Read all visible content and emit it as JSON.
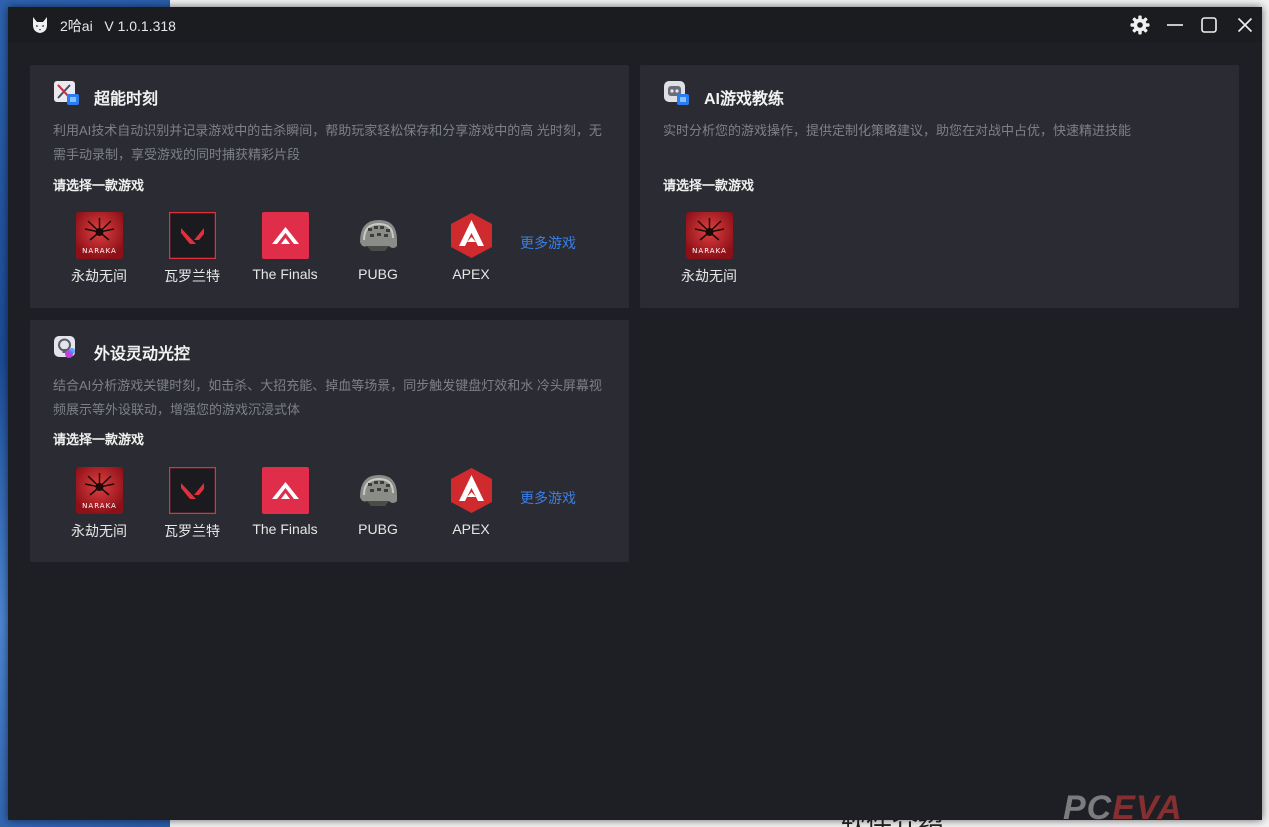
{
  "app": {
    "name_version": "2哈ai   V 1.0.1.318"
  },
  "backdrop": {
    "bottom_text": "软件介绍",
    "watermark_a": "PC",
    "watermark_b": "EVA"
  },
  "cards": [
    {
      "title": "超能时刻",
      "icon": "highlight-moment-icon",
      "description": "利用AI技术自动识别并记录游戏中的击杀瞬间，帮助玩家轻松保存和分享游戏中的高 光时刻，无需手动录制，享受游戏的同时捕获精彩片段",
      "prompt": "请选择一款游戏",
      "more": "更多游戏",
      "games": [
        {
          "label": "永劫无间",
          "icon": "naraka-icon",
          "icon_text": "NARAKA"
        },
        {
          "label": "瓦罗兰特",
          "icon": "valorant-icon"
        },
        {
          "label": "The Finals",
          "icon": "the-finals-icon"
        },
        {
          "label": "PUBG",
          "icon": "pubg-helmet-icon"
        },
        {
          "label": "APEX",
          "icon": "apex-icon"
        }
      ]
    },
    {
      "title": "AI游戏教练",
      "icon": "ai-coach-icon",
      "description": "实时分析您的游戏操作，提供定制化策略建议，助您在对战中占优，快速精进技能",
      "prompt": "请选择一款游戏",
      "games": [
        {
          "label": "永劫无间",
          "icon": "naraka-icon",
          "icon_text": "NARAKA"
        }
      ]
    },
    {
      "title": "外设灵动光控",
      "icon": "peripheral-light-icon",
      "description": "结合AI分析游戏关键时刻，如击杀、大招充能、掉血等场景，同步触发键盘灯效和水 冷头屏幕视频展示等外设联动，增强您的游戏沉浸式体",
      "prompt": "请选择一款游戏",
      "more": "更多游戏",
      "games": [
        {
          "label": "永劫无间",
          "icon": "naraka-icon",
          "icon_text": "NARAKA"
        },
        {
          "label": "瓦罗兰特",
          "icon": "valorant-icon"
        },
        {
          "label": "The Finals",
          "icon": "the-finals-icon"
        },
        {
          "label": "PUBG",
          "icon": "pubg-helmet-icon"
        },
        {
          "label": "APEX",
          "icon": "apex-icon"
        }
      ]
    }
  ],
  "colors": {
    "window_bg": "#1e1f25",
    "card_bg": "#2b2c33",
    "link": "#3a7ee8",
    "accent_red": "#e0303e"
  }
}
